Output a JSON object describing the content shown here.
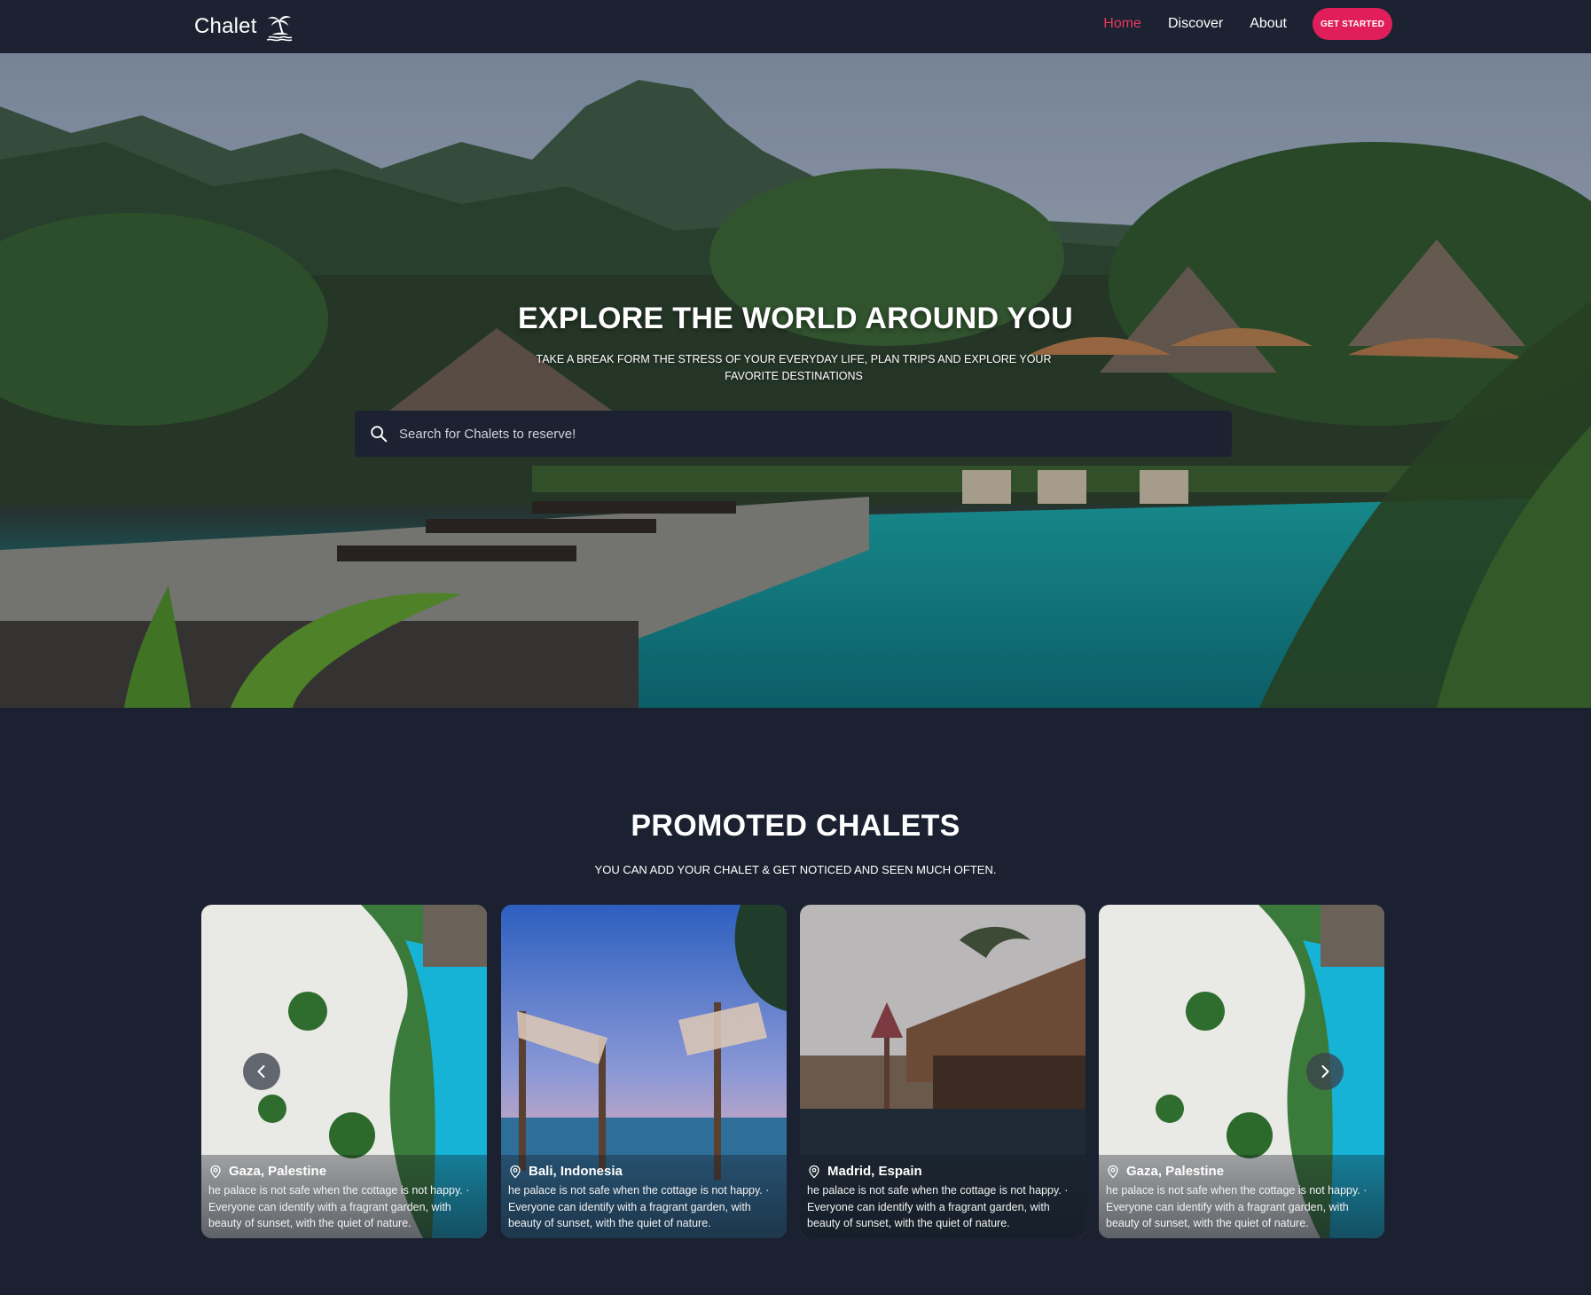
{
  "nav": {
    "brand": "Chalet",
    "brand_icon": "palm-island-icon",
    "links": [
      "Home",
      "Discover",
      "About"
    ],
    "active_link": "Home",
    "cta": "GET STARTED",
    "accent_color": "#e01f5a"
  },
  "hero": {
    "title": "EXPLORE THE WORLD AROUND YOU",
    "subtitle": "TAKE A BREAK FORM THE STRESS OF YOUR EVERYDAY LIFE, PLAN TRIPS AND EXPLORE YOUR FAVORITE DESTINATIONS",
    "search_placeholder": "Search for Chalets to reserve!",
    "search_icon": "search-icon"
  },
  "promoted": {
    "title": "PROMOTED CHALETS",
    "subtitle": "YOU CAN ADD YOUR CHALET & GET NOTICED AND SEEN MUCH OFTEN.",
    "cards": [
      {
        "location": "Gaza, Palestine",
        "description": "he palace is not safe when the cottage is not happy. · Everyone can identify with a fragrant garden, with beauty of sunset, with the quiet of nature."
      },
      {
        "location": "Bali, Indonesia",
        "description": "he palace is not safe when the cottage is not happy. · Everyone can identify with a fragrant garden, with beauty of sunset, with the quiet of nature."
      },
      {
        "location": "Madrid, Espain",
        "description": "he palace is not safe when the cottage is not happy. · Everyone can identify with a fragrant garden, with beauty of sunset, with the quiet of nature."
      },
      {
        "location": "Gaza, Palestine",
        "description": "he palace is not safe when the cottage is not happy. · Everyone can identify with a fragrant garden, with beauty of sunset, with the quiet of nature."
      }
    ],
    "prev_icon": "chevron-left-icon",
    "next_icon": "chevron-right-icon"
  }
}
